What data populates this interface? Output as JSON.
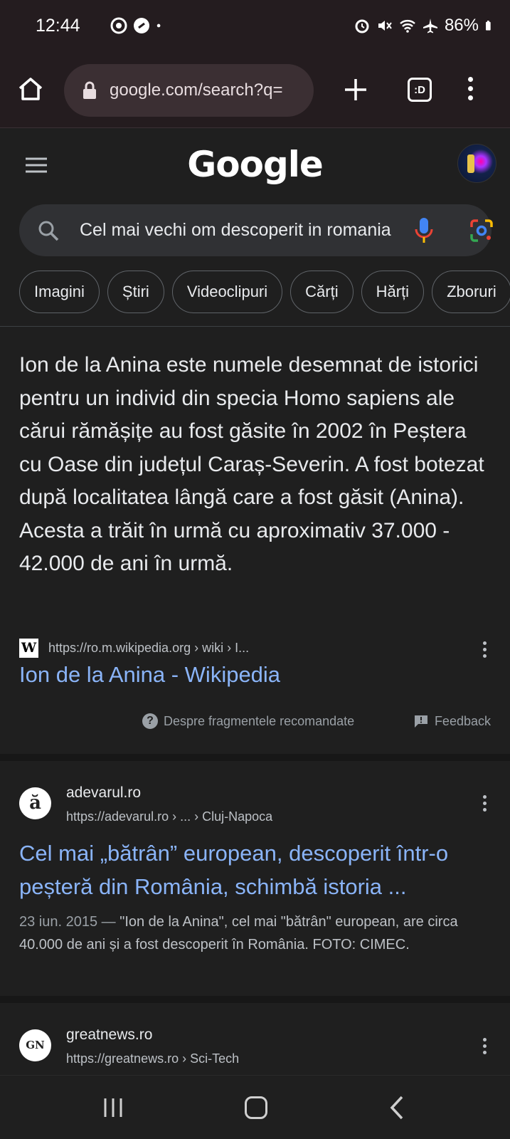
{
  "status_bar": {
    "time": "12:44",
    "battery": "86%",
    "left_icons": [
      "chrome-icon",
      "link-icon",
      "dot-icon"
    ],
    "right_icons": [
      "alarm-icon",
      "mute-icon",
      "wifi-icon",
      "airplane-icon",
      "battery-icon"
    ]
  },
  "browser": {
    "url": "google.com/search?q=",
    "tab_switcher_label": ":D"
  },
  "google": {
    "logo": "Google",
    "search_query": "Cel mai vechi om descoperit in romania"
  },
  "chips": [
    "Imagini",
    "Știri",
    "Videoclipuri",
    "Cărți",
    "Hărți",
    "Zboruri"
  ],
  "featured_snippet": {
    "text": "Ion de la Anina este numele desemnat de istorici pentru un individ din specia Homo sapiens ale cărui rămășițe au fost găsite în 2002 în Peștera cu Oase din județul Caraș-Severin. A fost botezat după localitatea lângă care a fost găsit (Anina). Acesta a trăit în urmă cu aproximativ 37.000 - 42.000 de ani în urmă.",
    "source_url": "https://ro.m.wikipedia.org › wiki › I...",
    "title": "Ion de la Anina - Wikipedia",
    "about_label": "Despre fragmentele recomandate",
    "feedback_label": "Feedback"
  },
  "results": [
    {
      "site_name": "adevarul.ro",
      "favicon_letter": "ă",
      "url": "https://adevarul.ro › ... › Cluj-Napoca",
      "title": "Cel mai „bătrân” european, descoperit într-o peșteră din România, schimbă istoria ...",
      "date": "23 iun. 2015 — ",
      "description": "\"Ion de la Anina\", cel mai \"bătrân\" european, are circa 40.000 de ani și a fost descoperit în România. FOTO: CIMEC."
    },
    {
      "site_name": "greatnews.ro",
      "favicon_letter": "GN",
      "url": "https://greatnews.ro › Sci-Tech"
    }
  ],
  "colors": {
    "background": "#1f1f1f",
    "link": "#8ab4f8",
    "toolbar": "#241c1f"
  }
}
